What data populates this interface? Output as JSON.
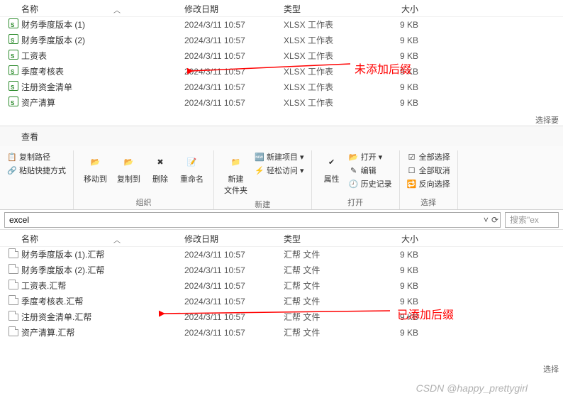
{
  "columns": {
    "name": "名称",
    "date": "修改日期",
    "type": "类型",
    "size": "大小"
  },
  "annotations": {
    "top": "未添加后缀",
    "bottom": "已添加后缀"
  },
  "topFiles": [
    {
      "name": "财务季度版本 (1)",
      "date": "2024/3/11 10:57",
      "type": "XLSX 工作表",
      "size": "9 KB"
    },
    {
      "name": "财务季度版本 (2)",
      "date": "2024/3/11 10:57",
      "type": "XLSX 工作表",
      "size": "9 KB"
    },
    {
      "name": "工资表",
      "date": "2024/3/11 10:57",
      "type": "XLSX 工作表",
      "size": "9 KB"
    },
    {
      "name": "季度考核表",
      "date": "2024/3/11 10:57",
      "type": "XLSX 工作表",
      "size": "9 KB"
    },
    {
      "name": "注册资金清单",
      "date": "2024/3/11 10:57",
      "type": "XLSX 工作表",
      "size": "9 KB"
    },
    {
      "name": "资产清算",
      "date": "2024/3/11 10:57",
      "type": "XLSX 工作表",
      "size": "9 KB"
    }
  ],
  "topStatus": "选择要",
  "viewTab": "查看",
  "ribbon": {
    "copyPath": "复制路径",
    "pasteShortcut": "粘贴快捷方式",
    "moveTo": "移动到",
    "copyTo": "复制到",
    "delete": "删除",
    "rename": "重命名",
    "organize": "组织",
    "newFolder": "新建\n文件夹",
    "newItem": "新建项目 ▾",
    "easyAccess": "轻松访问 ▾",
    "new": "新建",
    "properties": "属性",
    "open": "打开 ▾",
    "edit": "编辑",
    "history": "历史记录",
    "openGroup": "打开",
    "selectAll": "全部选择",
    "selectNone": "全部取消",
    "invertSelection": "反向选择",
    "select": "选择"
  },
  "breadcrumb": {
    "path": "excel",
    "search": "搜索\"ex"
  },
  "bottomFiles": [
    {
      "name": "财务季度版本 (1).汇帮",
      "date": "2024/3/11 10:57",
      "type": "汇帮 文件",
      "size": "9 KB"
    },
    {
      "name": "财务季度版本 (2).汇帮",
      "date": "2024/3/11 10:57",
      "type": "汇帮 文件",
      "size": "9 KB"
    },
    {
      "name": "工资表.汇帮",
      "date": "2024/3/11 10:57",
      "type": "汇帮 文件",
      "size": "9 KB"
    },
    {
      "name": "季度考核表.汇帮",
      "date": "2024/3/11 10:57",
      "type": "汇帮 文件",
      "size": "9 KB"
    },
    {
      "name": "注册资金清单.汇帮",
      "date": "2024/3/11 10:57",
      "type": "汇帮 文件",
      "size": "9 KB"
    },
    {
      "name": "资产清算.汇帮",
      "date": "2024/3/11 10:57",
      "type": "汇帮 文件",
      "size": "9 KB"
    }
  ],
  "bottomStatus": "选择",
  "watermark": "CSDN @happy_prettygirl"
}
